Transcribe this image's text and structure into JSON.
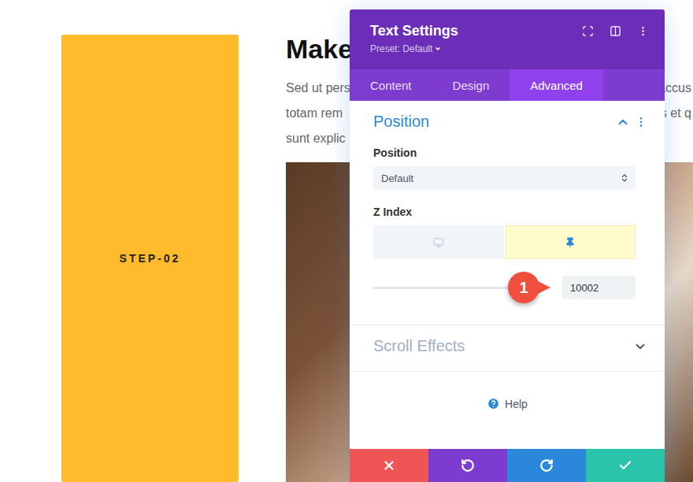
{
  "page": {
    "step_button": "STEP-02",
    "heading": "Make",
    "paragraph": [
      {
        "left": "Sed ut pers",
        "right": "accus"
      },
      {
        "left": "totam rem",
        "right": "s et q"
      },
      {
        "left": "sunt explic",
        "right": ""
      }
    ]
  },
  "modal": {
    "title": "Text Settings",
    "preset": "Preset: Default",
    "tabs": [
      {
        "label": "Content",
        "selected": false
      },
      {
        "label": "Design",
        "selected": false
      },
      {
        "label": "Advanced",
        "selected": true
      }
    ],
    "section": {
      "title": "Position",
      "expanded": true,
      "position_label": "Position",
      "position_value": "Default",
      "zindex_label": "Z Index",
      "devices": [
        {
          "kind": "desktop",
          "selected": false
        },
        {
          "kind": "pinned",
          "selected": true
        }
      ],
      "slider": {
        "level": 1,
        "value": "10002"
      },
      "annotation": "1"
    },
    "collapsed_sections": [
      {
        "title": "Scroll Effects",
        "expanded": false
      }
    ],
    "help": "Help",
    "footer_buttons": [
      {
        "kind": "cancel",
        "color": "#ef5555"
      },
      {
        "kind": "undo",
        "color": "#7e3bd0"
      },
      {
        "kind": "redo",
        "color": "#2b87da"
      },
      {
        "kind": "save",
        "color": "#29c4a9"
      }
    ]
  }
}
